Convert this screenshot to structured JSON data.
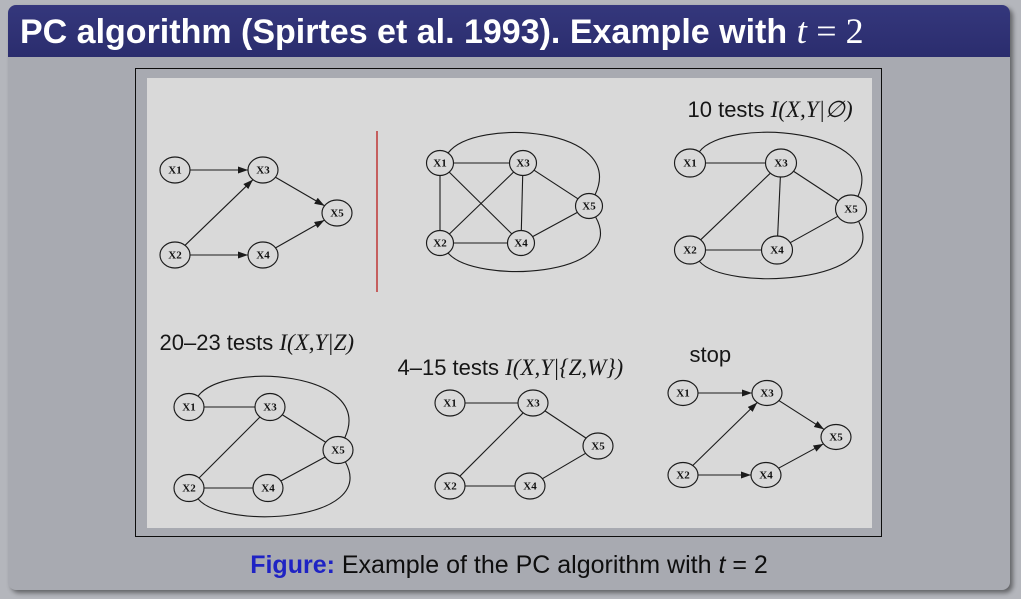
{
  "title": {
    "text": "PC algorithm (Spirtes et al. 1993). Example with",
    "math_var": "t",
    "math_rest": "= 2"
  },
  "figure": {
    "panels": [
      {
        "directed": true,
        "nodes": [
          "X1",
          "X2",
          "X3",
          "X4",
          "X5"
        ],
        "edges": [
          [
            0,
            2
          ],
          [
            1,
            2
          ],
          [
            2,
            4
          ],
          [
            1,
            3
          ],
          [
            3,
            4
          ]
        ]
      },
      {
        "directed": false,
        "nodes": [
          "X1",
          "X2",
          "X3",
          "X4",
          "X5"
        ],
        "edges": [
          [
            0,
            2
          ],
          [
            0,
            1
          ],
          [
            0,
            3
          ],
          [
            1,
            2
          ],
          [
            2,
            3
          ],
          [
            2,
            4
          ],
          [
            1,
            3
          ],
          [
            3,
            4
          ],
          [
            0,
            4
          ],
          [
            1,
            4
          ]
        ]
      },
      {
        "label": "10 tests",
        "math": "I(X,Y|∅)",
        "directed": false,
        "nodes": [
          "X1",
          "X2",
          "X3",
          "X4",
          "X5"
        ],
        "edges": [
          [
            0,
            2
          ],
          [
            1,
            2
          ],
          [
            2,
            3
          ],
          [
            2,
            4
          ],
          [
            1,
            3
          ],
          [
            3,
            4
          ],
          [
            0,
            4
          ],
          [
            1,
            4
          ]
        ]
      },
      {
        "label": "20–23 tests",
        "math": "I(X,Y|Z)",
        "directed": false,
        "nodes": [
          "X1",
          "X2",
          "X3",
          "X4",
          "X5"
        ],
        "edges": [
          [
            0,
            2
          ],
          [
            1,
            2
          ],
          [
            2,
            4
          ],
          [
            1,
            3
          ],
          [
            3,
            4
          ],
          [
            0,
            4
          ],
          [
            1,
            4
          ]
        ]
      },
      {
        "label": "4–15 tests",
        "math": "I(X,Y|{Z,W})",
        "directed": false,
        "nodes": [
          "X1",
          "X2",
          "X3",
          "X4",
          "X5"
        ],
        "edges": [
          [
            0,
            2
          ],
          [
            1,
            2
          ],
          [
            2,
            4
          ],
          [
            1,
            3
          ],
          [
            3,
            4
          ]
        ]
      },
      {
        "label": "stop",
        "directed": true,
        "nodes": [
          "X1",
          "X2",
          "X3",
          "X4",
          "X5"
        ],
        "edges": [
          [
            0,
            2
          ],
          [
            1,
            2
          ],
          [
            2,
            4
          ],
          [
            1,
            3
          ],
          [
            3,
            4
          ]
        ]
      }
    ]
  },
  "caption": {
    "prefix": "Figure:",
    "text": "Example of the PC algorithm with",
    "math_var": "t",
    "math_rest": "= 2"
  },
  "colors": {
    "title_bar": "#2b2d6e",
    "title_text": "#ffffff",
    "slide_body": "#a8aab1",
    "figure_bg": "#d9d9d9",
    "caption_prefix": "#1f23c4",
    "divider": "#c0403f"
  }
}
